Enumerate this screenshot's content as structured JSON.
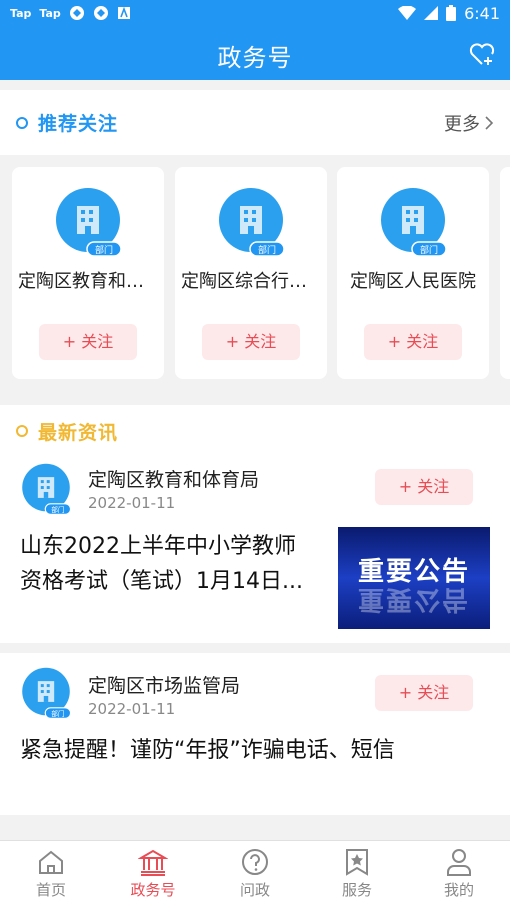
{
  "status_bar": {
    "left_items": [
      "Tap",
      "Tap"
    ],
    "time": "6:41"
  },
  "app_bar": {
    "title": "政务号"
  },
  "recommend": {
    "title": "推荐关注",
    "more_label": "更多",
    "cards": [
      {
        "name": "定陶区教育和体育局",
        "badge": "部门",
        "follow_label": "+ 关注"
      },
      {
        "name": "定陶区综合行政执法局",
        "badge": "部门",
        "follow_label": "+ 关注"
      },
      {
        "name": "定陶区人民医院",
        "badge": "部门",
        "follow_label": "+ 关注"
      }
    ]
  },
  "news": {
    "title": "最新资讯",
    "items": [
      {
        "source": "定陶区教育和体育局",
        "badge": "部门",
        "date": "2022-01-11",
        "follow_label": "+ 关注",
        "title_line1": "山东2022上半年中小学教师",
        "title_line2": "资格考试（笔试）1月14日...",
        "thumb_text": "重要公告"
      },
      {
        "source": "定陶区市场监管局",
        "badge": "部门",
        "date": "2022-01-11",
        "follow_label": "+ 关注",
        "title_line1": "紧急提醒！谨防“年报”诈骗电话、短信"
      }
    ]
  },
  "tabs": [
    {
      "label": "首页",
      "icon": "home-icon"
    },
    {
      "label": "政务号",
      "icon": "government-building-icon",
      "active": true
    },
    {
      "label": "问政",
      "icon": "question-icon"
    },
    {
      "label": "服务",
      "icon": "star-bookmark-icon"
    },
    {
      "label": "我的",
      "icon": "person-icon"
    }
  ],
  "colors": {
    "primary": "#2196f3",
    "accent_red": "#e84c55",
    "follow_bg": "#fde9ea",
    "news_accent": "#f1b833"
  }
}
